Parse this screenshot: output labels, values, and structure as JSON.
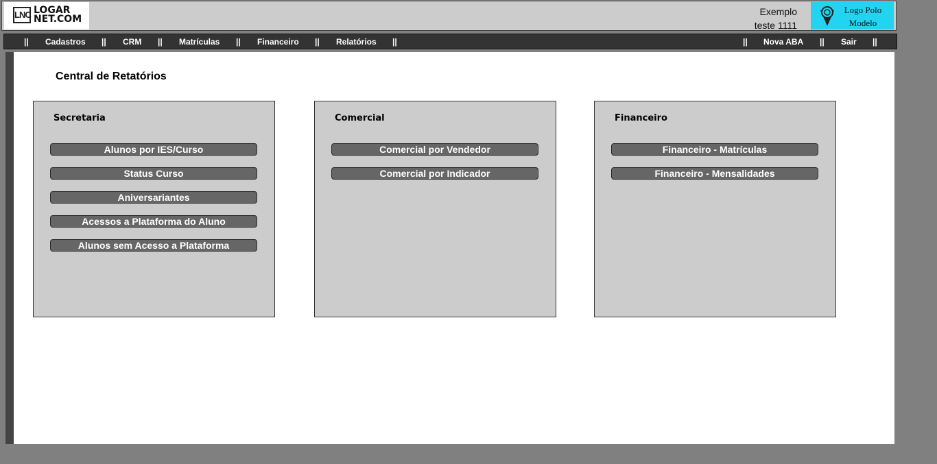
{
  "header": {
    "logo_alt": "LNC LOGARNET.COM",
    "logo_mark": "LNC",
    "logo_line1": "LOGAR",
    "logo_line2": "NET.COM",
    "user_line1": "Exemplo",
    "user_line2": "teste 1111",
    "polo_line1": "Logo Polo",
    "polo_line2": "Modelo",
    "polo_bg": "#22d4f0"
  },
  "nav": {
    "separator": "||",
    "left": [
      "Cadastros",
      "CRM",
      "Matrículas",
      "Financeiro",
      "Relatórios"
    ],
    "right": [
      "Nova ABA",
      "Sair"
    ]
  },
  "main": {
    "title": "Central de Retatórios",
    "panels": [
      {
        "title": "Secretaria",
        "buttons": [
          "Alunos por IES/Curso",
          "Status Curso",
          "Aniversariantes",
          "Acessos a Plataforma do Aluno",
          "Alunos sem Acesso a Plataforma"
        ]
      },
      {
        "title": "Comercial",
        "buttons": [
          "Comercial por Vendedor",
          "Comercial por Indicador"
        ]
      },
      {
        "title": "Financeiro",
        "buttons": [
          "Financeiro - Matrículas",
          "Financeiro - Mensalidades"
        ]
      }
    ]
  },
  "colors": {
    "page_bg": "#808080",
    "header_bg": "#cccccc",
    "nav_bg": "#333333",
    "button_bg": "#666666",
    "panel_bg": "#cccccc"
  }
}
